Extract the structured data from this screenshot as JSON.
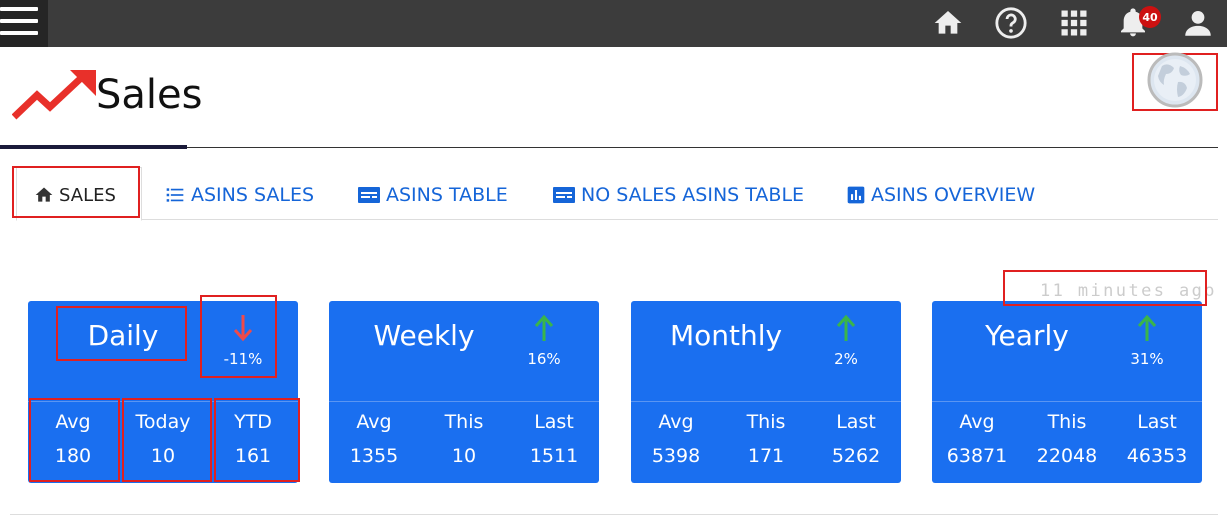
{
  "topbar": {
    "icons": [
      "hamburger-menu-icon",
      "home-icon",
      "help-icon",
      "apps-grid-icon",
      "bell-icon",
      "user-icon"
    ],
    "notification_count": "40"
  },
  "page": {
    "title": "Sales",
    "logo_icon": "trending-up-arrow-icon",
    "globe_icon": "globe-icon"
  },
  "tabs": [
    {
      "label": "SALES",
      "icon": "home-icon",
      "active": true
    },
    {
      "label": "ASINS SALES",
      "icon": "list-icon",
      "active": false
    },
    {
      "label": "ASINS TABLE",
      "icon": "table-icon",
      "active": false
    },
    {
      "label": "NO SALES ASINS TABLE",
      "icon": "table-icon",
      "active": false
    },
    {
      "label": "ASINS OVERVIEW",
      "icon": "bar-chart-icon",
      "active": false
    }
  ],
  "last_updated": "11 minutes ago",
  "cards": [
    {
      "period": "Daily",
      "trend": "down",
      "change": "-11%",
      "stats": [
        {
          "label": "Avg",
          "value": "180"
        },
        {
          "label": "Today",
          "value": "10"
        },
        {
          "label": "YTD",
          "value": "161"
        }
      ]
    },
    {
      "period": "Weekly",
      "trend": "up",
      "change": "16%",
      "stats": [
        {
          "label": "Avg",
          "value": "1355"
        },
        {
          "label": "This",
          "value": "10"
        },
        {
          "label": "Last",
          "value": "1511"
        }
      ]
    },
    {
      "period": "Monthly",
      "trend": "up",
      "change": "2%",
      "stats": [
        {
          "label": "Avg",
          "value": "5398"
        },
        {
          "label": "This",
          "value": "171"
        },
        {
          "label": "Last",
          "value": "5262"
        }
      ]
    },
    {
      "period": "Yearly",
      "trend": "up",
      "change": "31%",
      "stats": [
        {
          "label": "Avg",
          "value": "63871"
        },
        {
          "label": "This",
          "value": "22048"
        },
        {
          "label": "Last",
          "value": "46353"
        }
      ]
    }
  ],
  "colors": {
    "card_bg": "#1a6ff0",
    "trend_up": "#3ab54a",
    "trend_down": "#f04a4a",
    "tab_link": "#1565d8",
    "highlight": "#e02020"
  }
}
